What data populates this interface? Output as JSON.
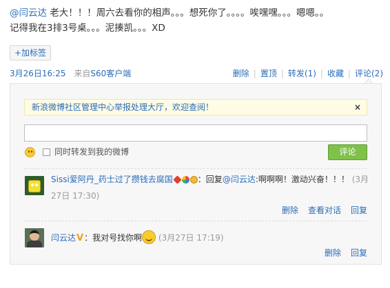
{
  "post": {
    "mention": "@闫云达",
    "text_line1": " 老大！！！周六去看你的相声。。。想死你了。。。。唉嘿嘿。。。嗯嗯。。",
    "text_line2": "记得我在3排3号桌。。。泥揍凯。。。XD",
    "tag_button": "+加标签",
    "time": "3月26日16:25",
    "source_prefix": "来自",
    "source": "S60客户端",
    "actions": {
      "delete": "删除",
      "pin": "置顶",
      "forward": "转发(1)",
      "favorite": "收藏",
      "comment": "评论(2)"
    }
  },
  "comment_box": {
    "notice": "新浪微博社区管理中心举报处理大厅，欢迎查阅！",
    "notice_close": "×",
    "input_value": "",
    "forward_label": "同时转发到我的微博",
    "submit_label": "评论"
  },
  "comments": [
    {
      "name": "Sissi爱阿丹_药士过了攒钱去腐国",
      "prefix": "：回复",
      "mention": "@闫云达",
      "text": ":啊啊啊！激动兴奋！！！",
      "time": "(3月27日 17:30)",
      "badges": [
        "star-badge",
        "flower-badge",
        "medal-badge"
      ],
      "actions": {
        "delete": "删除",
        "view": "查看对话",
        "reply": "回复"
      }
    },
    {
      "name": "闫云达",
      "verified": "V",
      "text": "：我对号找你啊",
      "time": "(3月27日 17:19)",
      "actions": {
        "delete": "删除",
        "reply": "回复"
      }
    }
  ],
  "colors": {
    "link": "#2a6cb8",
    "submit": "#7ec24a",
    "notice_bg": "#fffce6"
  }
}
